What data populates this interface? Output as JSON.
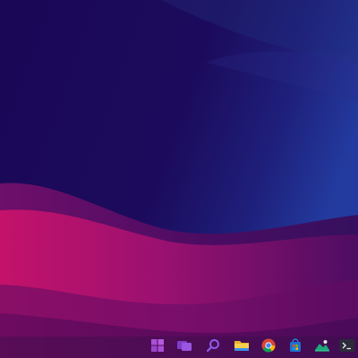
{
  "colors": {
    "wallpaper_dark": "#1a0756",
    "wallpaper_top_right": "#1d2a8c",
    "wave_magenta": "#c0136a",
    "wave_purple": "#7a0f6e",
    "wave_deep": "#3a0a5e",
    "taskbar_tint": "#301046"
  },
  "taskbar": {
    "items": [
      {
        "name": "start",
        "icon": "windows-logo-icon"
      },
      {
        "name": "task-view",
        "icon": "task-view-icon"
      },
      {
        "name": "search",
        "icon": "search-icon"
      },
      {
        "name": "file-explorer",
        "icon": "folder-icon"
      },
      {
        "name": "chrome",
        "icon": "chrome-icon"
      },
      {
        "name": "store",
        "icon": "store-icon"
      },
      {
        "name": "photos",
        "icon": "photos-icon"
      },
      {
        "name": "terminal",
        "icon": "terminal-icon"
      }
    ]
  }
}
